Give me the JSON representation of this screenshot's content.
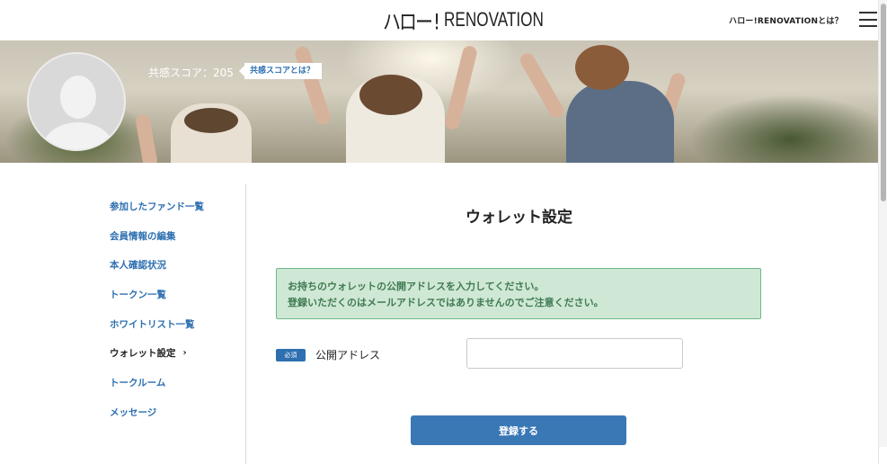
{
  "header": {
    "logo_mark": "ハロー!",
    "logo_text": "RENOVATION",
    "about_link": "ハロー!RENOVATIONとは？"
  },
  "hero": {
    "score_text": "共感スコア：205",
    "score_help": "共感スコアとは？"
  },
  "sidebar": {
    "items": [
      {
        "label": "参加したファンド一覧",
        "active": false
      },
      {
        "label": "会員情報の編集",
        "active": false
      },
      {
        "label": "本人確認状況",
        "active": false
      },
      {
        "label": "トークン一覧",
        "active": false
      },
      {
        "label": "ホワイトリスト一覧",
        "active": false
      },
      {
        "label": "ウォレット設定",
        "active": true
      },
      {
        "label": "トークルーム",
        "active": false
      },
      {
        "label": "メッセージ",
        "active": false
      }
    ],
    "active_chevron": "›"
  },
  "main": {
    "title": "ウォレット設定",
    "notice_line1": "お持ちのウォレットの公開アドレスを入力してください。",
    "notice_line2": "登録いただくのはメールアドレスではありませんのでご注意ください。",
    "required_badge": "必須",
    "field_label": "公開アドレス",
    "field_value": "",
    "submit_label": "登録する"
  },
  "colors": {
    "accent": "#2d6fb0",
    "button": "#3a78b5",
    "notice_bg": "#cfe8d5",
    "notice_border": "#6fb886",
    "notice_text": "#3f7a52"
  },
  "icons": {
    "menu": "hamburger-icon",
    "chevron": "chevron-right-icon",
    "avatar": "default-avatar-icon"
  }
}
